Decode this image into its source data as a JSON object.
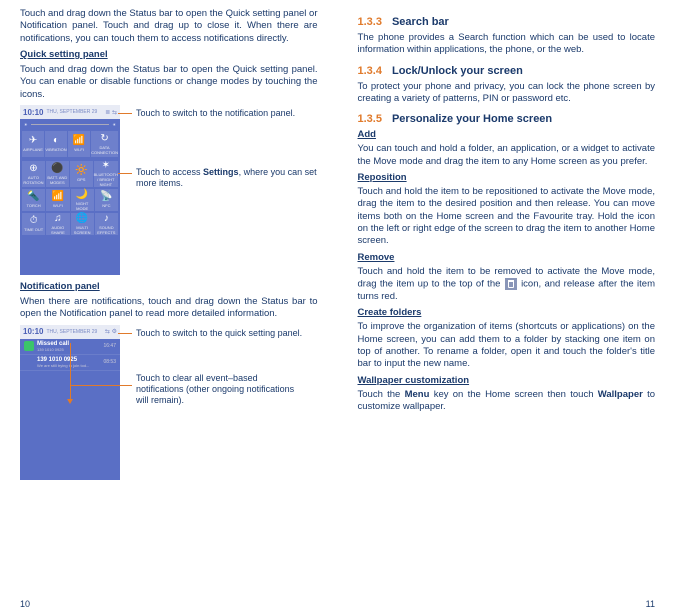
{
  "left": {
    "intro": "Touch and drag down the Status bar to open the Quick setting panel or Notification panel. Touch and drag up to close it. When there are notifications, you can touch them to access notifications directly.",
    "quick_heading": "Quick setting panel",
    "quick_body": "Touch and drag down the Status bar to open the Quick setting panel. You can enable or disable functions or change modes by touching the icons.",
    "quick_shot": {
      "time": "10:10",
      "date": "THU, SEPTEMBER 29",
      "tiles_row1": [
        {
          "icon": "✈",
          "label": "AIRPLANE"
        },
        {
          "icon": "◐",
          "label": "VIBRATION"
        },
        {
          "icon": "📶",
          "label": "WI-FI"
        },
        {
          "icon": "↻",
          "label": "DATA CONNECTION"
        }
      ],
      "tiles_row2": [
        {
          "icon": "⊕",
          "label": "AUTO ROTATION"
        },
        {
          "icon": "⚫",
          "label": "BATT. AND MODES"
        },
        {
          "icon": "🔆",
          "label": "GPS"
        },
        {
          "icon": "✶",
          "label": "BLUETOOTH / BRIGHT NIGHT"
        }
      ],
      "tiles_row3": [
        {
          "icon": "🔦",
          "label": "TORCH"
        },
        {
          "icon": "📶",
          "label": "WI-FI"
        },
        {
          "icon": "🌙",
          "label": "NIGHT MODE"
        },
        {
          "icon": "📡",
          "label": "NFC"
        }
      ],
      "tiles_row4": [
        {
          "icon": "⏱",
          "label": "TIME OUT"
        },
        {
          "icon": "♫",
          "label": "AUDIO SHARE"
        },
        {
          "icon": "🌐",
          "label": "MULTI SCREEN"
        },
        {
          "icon": "♪",
          "label": "SOUND EFFECTS"
        }
      ]
    },
    "callout_quick_1": "Touch to switch to the notification panel.",
    "callout_quick_2a": "Touch to access ",
    "callout_quick_2b": "Settings",
    "callout_quick_2c": ", where you can set more items.",
    "notif_heading": "Notification panel",
    "notif_body": "When there are notifications, touch and drag down the Status bar to open the Notification panel to read more detailed information.",
    "notif_shot": {
      "time": "10:10",
      "date": "THU, SEPTEMBER 29",
      "items": [
        {
          "title": "Missed call",
          "sub": "139 1010 0925",
          "time": "16:47"
        },
        {
          "title": "139 1010 0925",
          "sub": "We are still trying to join tod...",
          "time": "08:53"
        }
      ]
    },
    "callout_notif_1": "Touch to switch to the quick setting panel.",
    "callout_notif_2": "Touch to clear all event–based notifications (other ongoing notifications will remain).",
    "page_num": "10"
  },
  "right": {
    "h133_num": "1.3.3",
    "h133_title": "Search bar",
    "p133": "The phone provides a Search function which can be used to locate information within applications, the phone, or the web.",
    "h134_num": "1.3.4",
    "h134_title": "Lock/Unlock your screen",
    "p134": "To protect your phone and privacy, you can lock the phone screen by creating a variety of patterns, PIN or password etc.",
    "h135_num": "1.3.5",
    "h135_title": "Personalize your Home screen",
    "add_h": "Add",
    "add_p": "You can touch and hold a folder, an application, or a widget to activate the Move mode and drag the item to any Home screen as you prefer.",
    "repo_h": "Reposition ",
    "repo_p": "Touch and hold the item to be repositioned to activate the Move mode, drag the item to the desired position and then release.  You can move items both on the Home screen and the Favourite tray. Hold the icon on the left or right edge of the screen to drag the item to another Home screen.",
    "remove_h": "Remove",
    "remove_p1": "Touch and hold the item to be removed to activate the Move mode, drag the item up to the top of the ",
    "remove_p2": " icon, and release after the item turns red.",
    "folders_h": "Create folders",
    "folders_p": "To improve the organization of items (shortcuts or applications) on the Home screen, you can add them to a folder by stacking one item on top of another. To rename a folder, open it and touch the folder's title bar to input the new name.",
    "wall_h": "Wallpaper customization",
    "wall_p1": "Touch the ",
    "wall_menu": "Menu",
    "wall_p2": " key on the Home screen then touch ",
    "wall_wp": "Wallpaper",
    "wall_p3": " to customize wallpaper.",
    "page_num": "11"
  }
}
